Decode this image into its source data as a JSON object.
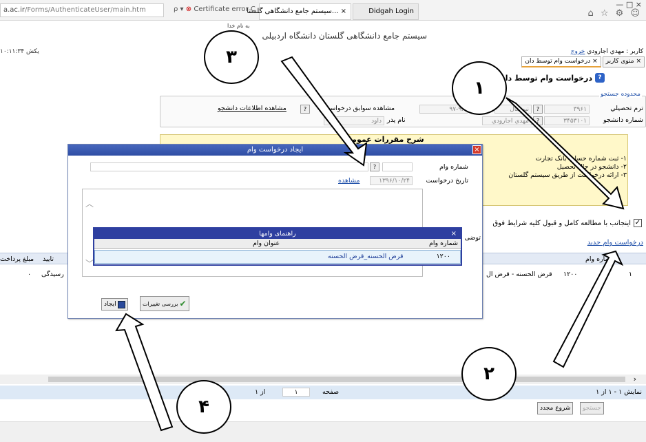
{
  "browser": {
    "address_host": "a.ac.ir",
    "address_path": "/Forms/AuthenticateUser/main.htm",
    "address_controls": "ρ ▾",
    "cert_error": "Certificate error",
    "refresh_glyph": "C",
    "tabs": [
      {
        "label": "...سیستم جامع دانشگاهی گلستا",
        "close": "×"
      },
      {
        "label": "Didgah Login"
      }
    ],
    "window_buttons": "—   □   ×",
    "favicons": "⌂ ☆ ⚙ ☺"
  },
  "header": {
    "bismillah": "به نام خدا",
    "system_title": "سیستم جامع دانشگاهی گلستان      دانشگاه اردبیلی",
    "clock": "۱۰:۱۱:۳۴ یکش",
    "user_label": "کاربر : مهدي اجارودي",
    "logout": "خروج",
    "tabs": [
      {
        "label": "منوی کاربر",
        "close": "×"
      },
      {
        "label": "درخواست وام توسط دان",
        "close": "×"
      }
    ]
  },
  "page": {
    "heading": "درخواست وام توسط دانشجو",
    "badge": "?",
    "search_legend": "محدوده جستجو",
    "term_label": "ترم تحصیلي",
    "term_value": "۳۹۶۱",
    "term_name": "نیمسال",
    "year_value": "۹۷-۹۶",
    "history_label": "مشاهده سوابق درخواست",
    "student_info_link": "مشاهده اطلاعات دانشجو",
    "student_no_label": "شماره دانشجو",
    "student_no_value": "۳۴۵۳۱۰۱",
    "student_name": "مهدي اجارودي",
    "father_label": "نام پدر",
    "father_value": "داود",
    "rules_title": "شرح مقررات عمومی",
    "rules_lines": [
      "۱- ثبت شماره حساب بانک تجارت",
      "۲- دانشجو در حال تحصیل",
      "۳- ارائه درخواست از طریق سیستم گلستان"
    ],
    "agree_text": "اینجانب با مطالعه کامل و قبول کلیه شرایط فوق",
    "agree_checked": "✓",
    "new_loan_link": "درخواست وام جدید"
  },
  "grid": {
    "columns": [
      "شماره وام",
      "تایید",
      "مبلغ پرداخت"
    ],
    "row": {
      "index": "۱",
      "loan_no": "۱۲۰۰",
      "title": "قرض الحسنه - قرض ال",
      "status": "رسیدگی",
      "amount": "۰"
    }
  },
  "pager": {
    "showing": "نمایش ۱ - ۱ از ۱",
    "page_label": "صفحه",
    "page_value": "۱",
    "of_label": "از ۱",
    "begin_button": "شروع مجدد",
    "search_button": "جستجو"
  },
  "dialog": {
    "title": "ایجاد درخواست وام",
    "close": "×",
    "loan_no_label": "شماره وام",
    "request_date_label": "تاریخ درخواست",
    "request_date_value": "۱۳۹۶/۱۰/۲۴",
    "view_link": "مشاهده",
    "desc_label": "توضی",
    "review_button": "بررسی تغییرات",
    "create_button": "ایجاد"
  },
  "hint": {
    "title": "راهنمای وامها",
    "close": "×",
    "col_no": "شماره وام",
    "col_title": "عنوان وام",
    "row_no": "۱۲۰۰",
    "row_title": "قرض الحسنه_قرض الحسنه"
  },
  "annotations": {
    "c1": "۱",
    "c2": "۲",
    "c3": "۳",
    "c4": "۴"
  }
}
